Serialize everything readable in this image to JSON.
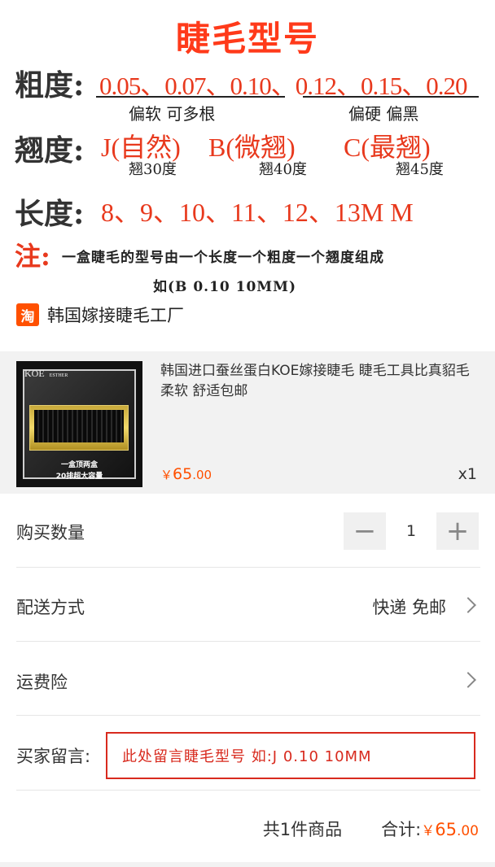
{
  "banner": {
    "title": "睫毛型号",
    "thickness_label": "粗度:",
    "thickness_values": "0.05、0.07、0.10、0.12、0.15、0.20",
    "thickness_soft": "偏软 可多根",
    "thickness_hard": "偏硬 偏黑",
    "curl_label": "翘度:",
    "curl_values": "J(自然)B(微翘)C(最翘)",
    "curl_j": "J(自然)",
    "curl_b": "B(微翘)",
    "curl_c": "C(最翘)",
    "curl_j_deg": "翘30度",
    "curl_b_deg": "翘40度",
    "curl_c_deg": "翘45度",
    "length_label": "长度:",
    "length_values": "8、9、10、11、12、13M M",
    "note_mark": "注:",
    "note_line1": "一盒睫毛的型号由一个长度一个粗度一个翘度组成",
    "note_line2": "如(B 0.10 10MM)"
  },
  "shop": {
    "icon": "淘",
    "name": "韩国嫁接睫毛工厂"
  },
  "product": {
    "title": "韩国进口蚕丝蛋白KOE嫁接睫毛 睫毛工具比真貂毛柔软 舒适包邮",
    "thumb_brand": "KOE",
    "thumb_brand_sub": "ESTHER",
    "thumb_caption1": "一盒顶两盒",
    "thumb_caption2": "20排超大容量",
    "price_currency": "￥",
    "price_int": "65",
    "price_dec": ".00",
    "qty": "x1"
  },
  "quantity": {
    "label": "购买数量",
    "minus": "−",
    "value": "1",
    "plus": "+"
  },
  "shipping": {
    "label": "配送方式",
    "value": "快递 免邮"
  },
  "insurance": {
    "label": "运费险"
  },
  "message": {
    "label": "买家留言:",
    "value": "此处留言睫毛型号 如:J 0.10 10MM"
  },
  "summary": {
    "count": "共1件商品",
    "total_label": "合计:",
    "currency": "￥",
    "total_int": "65",
    "total_dec": ".00"
  },
  "colors": {
    "accent": "#ff5000",
    "red": "#e8391d",
    "border_red": "#d82a1e"
  }
}
